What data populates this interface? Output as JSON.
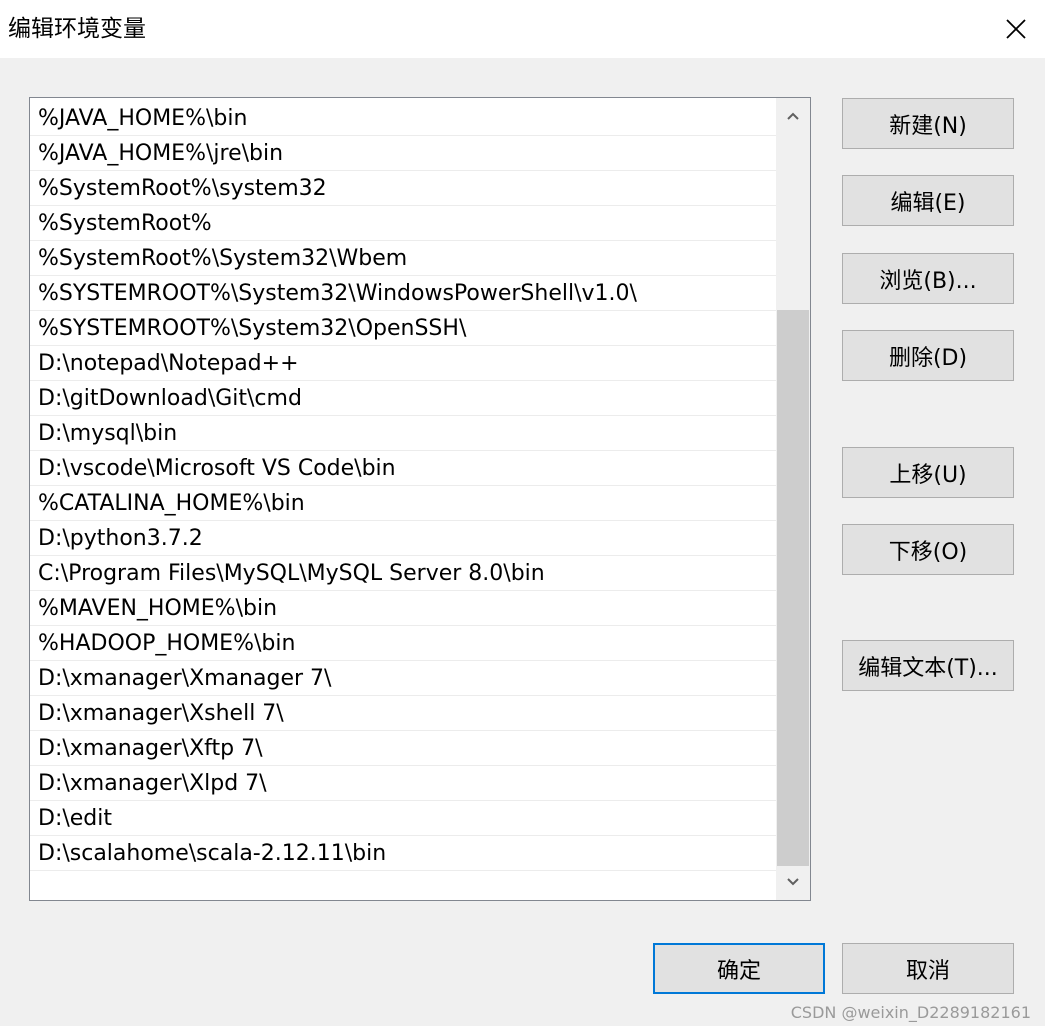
{
  "window": {
    "title": "编辑环境变量",
    "close_icon": "close-icon"
  },
  "paths": [
    "%JAVA_HOME%\\bin",
    "%JAVA_HOME%\\jre\\bin",
    "%SystemRoot%\\system32",
    "%SystemRoot%",
    "%SystemRoot%\\System32\\Wbem",
    "%SYSTEMROOT%\\System32\\WindowsPowerShell\\v1.0\\",
    "%SYSTEMROOT%\\System32\\OpenSSH\\",
    "D:\\notepad\\Notepad++",
    "D:\\gitDownload\\Git\\cmd",
    "D:\\mysql\\bin",
    "D:\\vscode\\Microsoft VS Code\\bin",
    "%CATALINA_HOME%\\bin",
    "D:\\python3.7.2",
    "C:\\Program Files\\MySQL\\MySQL Server 8.0\\bin",
    "%MAVEN_HOME%\\bin",
    "%HADOOP_HOME%\\bin",
    "D:\\xmanager\\Xmanager 7\\",
    "D:\\xmanager\\Xshell 7\\",
    "D:\\xmanager\\Xftp 7\\",
    "D:\\xmanager\\Xlpd 7\\",
    "D:\\edit",
    "D:\\scalahome\\scala-2.12.11\\bin"
  ],
  "buttons": {
    "new": "新建(N)",
    "edit": "编辑(E)",
    "browse": "浏览(B)...",
    "delete": "删除(D)",
    "move_up": "上移(U)",
    "move_down": "下移(O)",
    "edit_text": "编辑文本(T)...",
    "ok": "确定",
    "cancel": "取消"
  },
  "watermark": "CSDN @weixin_D2289182161",
  "colors": {
    "focus_border": "#0078d7",
    "scroll_thumb": "#cdcdcd"
  }
}
